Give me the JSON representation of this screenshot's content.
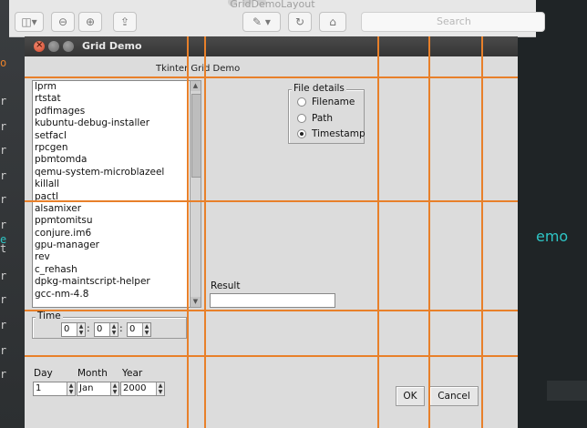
{
  "background": {
    "right_text": "emo",
    "left_glyphs": [
      "o",
      "r",
      "r",
      "r",
      "r",
      "r",
      "r",
      "e",
      "t",
      "r",
      "r",
      "r",
      "r",
      "r"
    ]
  },
  "mac_window": {
    "title": "GridDemoLayout",
    "search_placeholder": "Search"
  },
  "tk": {
    "window_title": "Grid Demo",
    "app_title": "Tkinter Grid Demo",
    "listbox_items": [
      "lprm",
      "rtstat",
      "pdfimages",
      "kubuntu-debug-installer",
      "setfacl",
      "rpcgen",
      "pbmtomda",
      "qemu-system-microblazeel",
      "killall",
      "pactl",
      "alsamixer",
      "ppmtomitsu",
      "conjure.im6",
      "gpu-manager",
      "rev",
      "c_rehash",
      "dpkg-maintscript-helper",
      "gcc-nm-4.8"
    ],
    "file_details": {
      "title": "File details",
      "options": [
        {
          "label": "Filename",
          "selected": false
        },
        {
          "label": "Path",
          "selected": false
        },
        {
          "label": "Timestamp",
          "selected": true
        }
      ]
    },
    "result": {
      "label": "Result",
      "value": ""
    },
    "time": {
      "title": "Time",
      "hour": "0",
      "minute": "0",
      "second": "0",
      "separator": ":"
    },
    "date": {
      "day_label": "Day",
      "month_label": "Month",
      "year_label": "Year",
      "day": "1",
      "month": "Jan",
      "year": "2000"
    },
    "buttons": {
      "ok": "OK",
      "cancel": "Cancel"
    }
  },
  "colors": {
    "grid_line": "#e8802a",
    "accent_text": "#2ec5c5"
  }
}
